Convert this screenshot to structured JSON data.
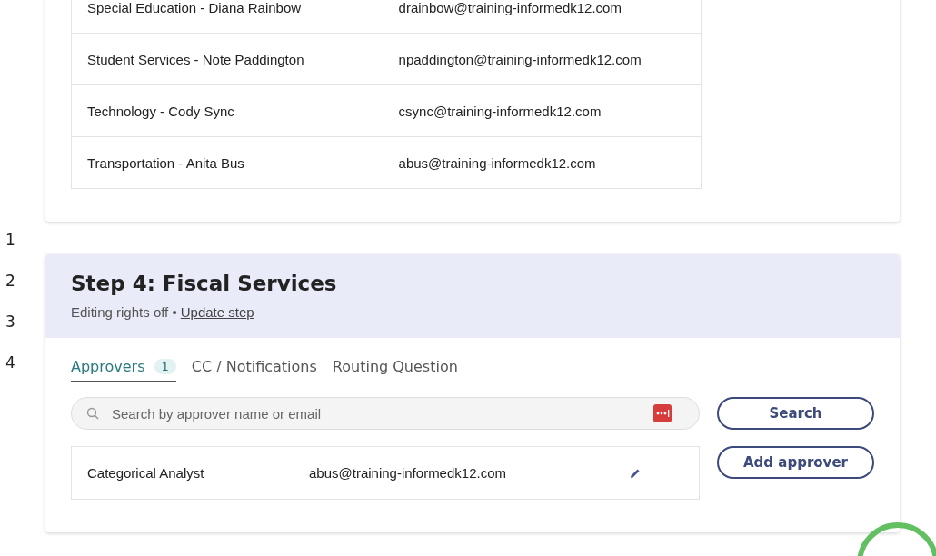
{
  "step_nav": [
    {
      "label": "1"
    },
    {
      "label": "2"
    },
    {
      "label": "3"
    },
    {
      "label": "4"
    }
  ],
  "contacts": [
    {
      "name": "Special Education - Diana Rainbow",
      "email": "drainbow@training-informedk12.com"
    },
    {
      "name": "Student Services - Note Paddington",
      "email": "npaddington@training-informedk12.com"
    },
    {
      "name": "Technology - Cody Sync",
      "email": "csync@training-informedk12.com"
    },
    {
      "name": "Transportation - Anita Bus",
      "email": "abus@training-informedk12.com"
    }
  ],
  "step": {
    "title": "Step 4: Fiscal Services",
    "status": "Editing rights off •",
    "link": "Update step"
  },
  "tabs": [
    {
      "label": "Approvers",
      "count": "1",
      "selected": true
    },
    {
      "label": "CC / Notifications",
      "selected": false
    },
    {
      "label": "Routing Question",
      "selected": false
    }
  ],
  "search": {
    "placeholder": "Search by approver name or email"
  },
  "approvers": [
    {
      "role": "Categorical Analyst",
      "email": "abus@training-informedk12.com"
    }
  ],
  "buttons": [
    "Search",
    "Add approver"
  ]
}
